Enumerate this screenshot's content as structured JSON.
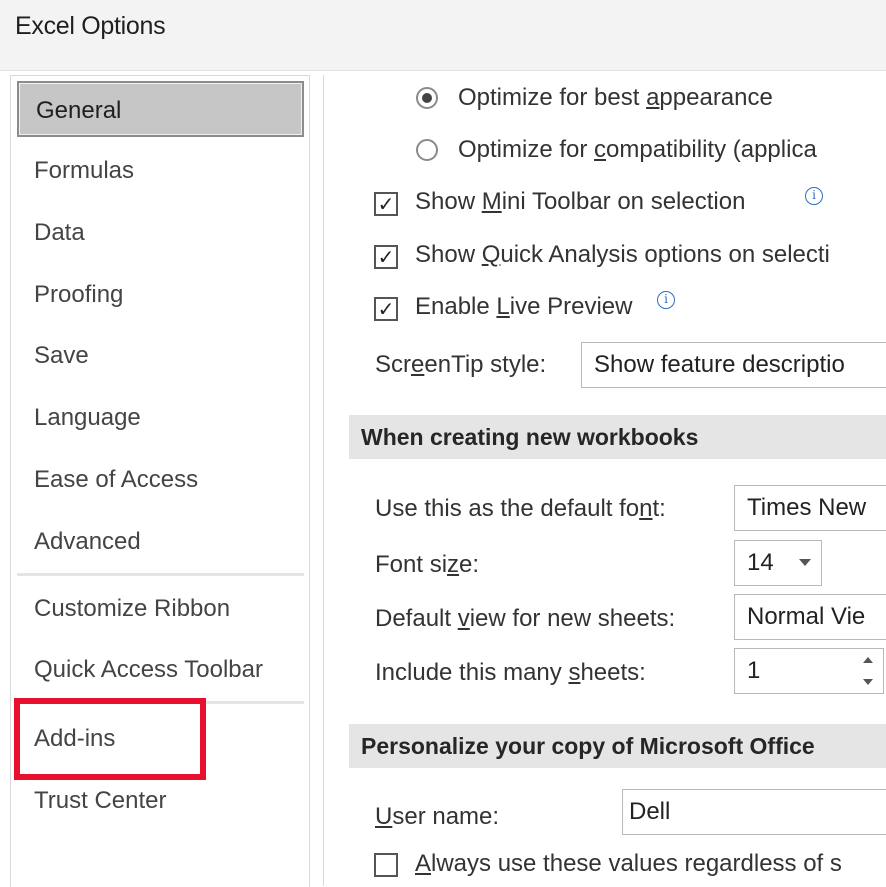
{
  "window": {
    "title": "Excel Options"
  },
  "sidebar": {
    "items": [
      {
        "label": "General"
      },
      {
        "label": "Formulas"
      },
      {
        "label": "Data"
      },
      {
        "label": "Proofing"
      },
      {
        "label": "Save"
      },
      {
        "label": "Language"
      },
      {
        "label": "Ease of Access"
      },
      {
        "label": "Advanced"
      },
      {
        "label": "Customize Ribbon"
      },
      {
        "label": "Quick Access Toolbar"
      },
      {
        "label": "Add-ins"
      },
      {
        "label": "Trust Center"
      }
    ],
    "selected": "General",
    "highlighted": "Add-ins"
  },
  "ui_options": {
    "radio_best_pre": "Optimize for best ",
    "radio_best_key": "a",
    "radio_best_post": "ppearance",
    "radio_compat_pre": "Optimize for ",
    "radio_compat_key": "c",
    "radio_compat_post": "ompatibility (applica",
    "mini_toolbar_pre": "Show ",
    "mini_toolbar_key": "M",
    "mini_toolbar_post": "ini Toolbar on selection",
    "quick_analysis_pre": "Show ",
    "quick_analysis_key": "Q",
    "quick_analysis_post": "uick Analysis options on selecti",
    "live_preview_pre": "Enable ",
    "live_preview_key": "L",
    "live_preview_post": "ive Preview",
    "screentip_label_pre": "Scr",
    "screentip_label_key": "e",
    "screentip_label_post": "enTip style:",
    "screentip_value": "Show feature descriptio",
    "check_mark": "✓",
    "info_glyph": "i"
  },
  "new_workbooks": {
    "heading": "When creating new workbooks",
    "font_label_pre": "Use this as the default fo",
    "font_label_key": "n",
    "font_label_post": "t:",
    "font_value": "Times New",
    "size_label_pre": "Font si",
    "size_label_key": "z",
    "size_label_post": "e:",
    "size_value": "14",
    "view_label_pre": "Default ",
    "view_label_key": "v",
    "view_label_post": "iew for new sheets:",
    "view_value": "Normal Vie",
    "sheets_label_pre": "Include this many ",
    "sheets_label_key": "s",
    "sheets_label_post": "heets:",
    "sheets_value": "1"
  },
  "personalize": {
    "heading": "Personalize your copy of Microsoft Office",
    "username_label_key": "U",
    "username_label_post": "ser name:",
    "username_value": "Dell",
    "always_use_key": "A",
    "always_use_post": "lways use these values regardless of s"
  }
}
